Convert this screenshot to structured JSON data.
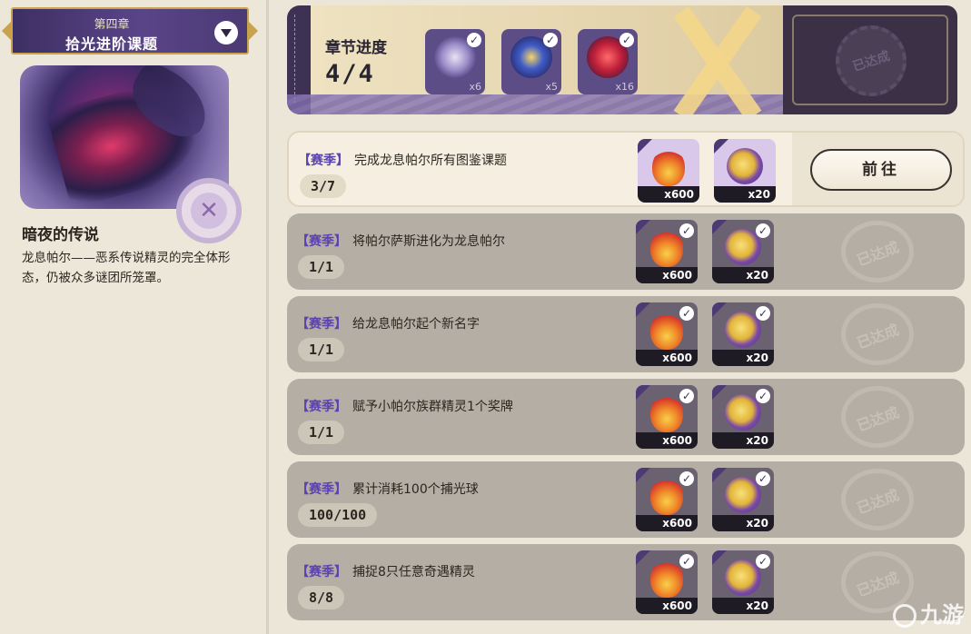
{
  "left_panel": {
    "chapter_number": "第四章",
    "chapter_title": "拾光进阶课题",
    "legend_title": "暗夜的传说",
    "legend_description": "龙息帕尔——恶系传说精灵的完全体形态，仍被众多谜团所笼罩。"
  },
  "progress": {
    "label": "章节进度",
    "value": "4/4",
    "rewards": [
      {
        "icon": "crystal-icon",
        "qty": "x6",
        "claimed": true
      },
      {
        "icon": "gem-icon",
        "qty": "x5",
        "claimed": true
      },
      {
        "icon": "red-stone-icon",
        "qty": "x16",
        "claimed": true
      }
    ],
    "stamp": "已达成"
  },
  "tasks": [
    {
      "tag": "【赛季】",
      "desc": "完成龙息帕尔所有图鉴课题",
      "count": "3/7",
      "status": "active",
      "action": "前往",
      "rewards": [
        {
          "icon": "flame-icon",
          "qty": "x600",
          "claimed": false
        },
        {
          "icon": "coin-icon",
          "qty": "x20",
          "claimed": false
        }
      ]
    },
    {
      "tag": "【赛季】",
      "desc": "将帕尔萨斯进化为龙息帕尔",
      "count": "1/1",
      "status": "done",
      "stamp": "已达成",
      "rewards": [
        {
          "icon": "flame-icon",
          "qty": "x600",
          "claimed": true
        },
        {
          "icon": "coin-icon",
          "qty": "x20",
          "claimed": true
        }
      ]
    },
    {
      "tag": "【赛季】",
      "desc": "给龙息帕尔起个新名字",
      "count": "1/1",
      "status": "done",
      "stamp": "已达成",
      "rewards": [
        {
          "icon": "flame-icon",
          "qty": "x600",
          "claimed": true
        },
        {
          "icon": "coin-icon",
          "qty": "x20",
          "claimed": true
        }
      ]
    },
    {
      "tag": "【赛季】",
      "desc": "赋予小帕尔族群精灵1个奖牌",
      "count": "1/1",
      "status": "done",
      "stamp": "已达成",
      "rewards": [
        {
          "icon": "flame-icon",
          "qty": "x600",
          "claimed": true
        },
        {
          "icon": "coin-icon",
          "qty": "x20",
          "claimed": true
        }
      ]
    },
    {
      "tag": "【赛季】",
      "desc": "累计消耗100个捕光球",
      "count": "100/100",
      "status": "done",
      "stamp": "已达成",
      "rewards": [
        {
          "icon": "flame-icon",
          "qty": "x600",
          "claimed": true
        },
        {
          "icon": "coin-icon",
          "qty": "x20",
          "claimed": true
        }
      ]
    },
    {
      "tag": "【赛季】",
      "desc": "捕捉8只任意奇遇精灵",
      "count": "8/8",
      "status": "done",
      "stamp": "已达成",
      "rewards": [
        {
          "icon": "flame-icon",
          "qty": "x600",
          "claimed": true
        },
        {
          "icon": "coin-icon",
          "qty": "x20",
          "claimed": true
        }
      ]
    }
  ],
  "watermark": "九游",
  "colors": {
    "accent_purple": "#5b43b0",
    "banner": "#4b3a74",
    "done_row": "#b4aea4",
    "active_row": "#f6efe1"
  }
}
